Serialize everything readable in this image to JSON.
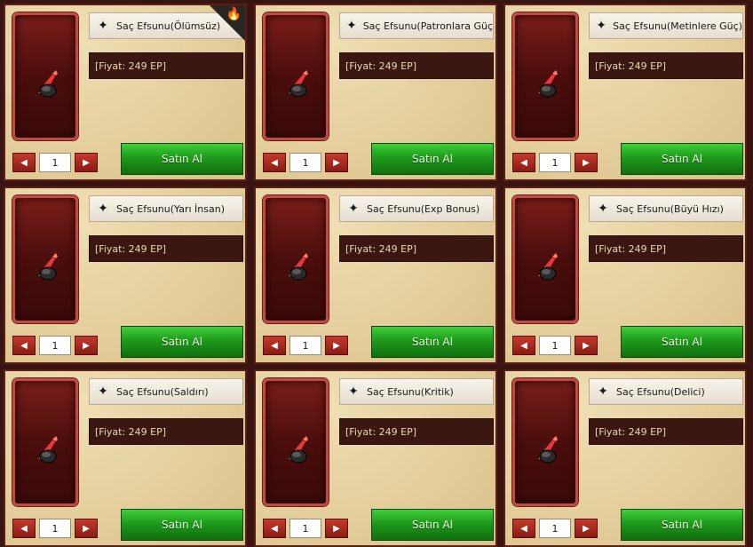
{
  "cards": [
    {
      "title": "Saç Efsunu(Ölümsüz)",
      "price": "[Fiyat: 249 EP]",
      "qty": "1",
      "buy": "Satın Al",
      "hot": true
    },
    {
      "title": "Saç Efsunu(Patronlara Güç",
      "price": "[Fiyat: 249 EP]",
      "qty": "1",
      "buy": "Satın Al",
      "hot": false
    },
    {
      "title": "Saç Efsunu(Metinlere Güç)",
      "price": "[Fiyat: 249 EP]",
      "qty": "1",
      "buy": "Satın Al",
      "hot": false
    },
    {
      "title": "Saç Efsunu(Yarı İnsan)",
      "price": "[Fiyat: 249 EP]",
      "qty": "1",
      "buy": "Satın Al",
      "hot": false
    },
    {
      "title": "Saç Efsunu(Exp Bonus)",
      "price": "[Fiyat: 249 EP]",
      "qty": "1",
      "buy": "Satın Al",
      "hot": false
    },
    {
      "title": "Saç Efsunu(Büyü Hızı)",
      "price": "[Fiyat: 249 EP]",
      "qty": "1",
      "buy": "Satın Al",
      "hot": false
    },
    {
      "title": "Saç Efsunu(Saldırı)",
      "price": "[Fiyat: 249 EP]",
      "qty": "1",
      "buy": "Satın Al",
      "hot": false
    },
    {
      "title": "Saç Efsunu(Kritik)",
      "price": "[Fiyat: 249 EP]",
      "qty": "1",
      "buy": "Satın Al",
      "hot": false
    },
    {
      "title": "Saç Efsunu(Delici)",
      "price": "[Fiyat: 249 EP]",
      "qty": "1",
      "buy": "Satın Al",
      "hot": false
    }
  ],
  "icons": {
    "title_icon": "sparkle-star-icon",
    "item_icon": "hair-item-icon",
    "hot_icon": "flame-icon",
    "prev": "arrow-left-icon",
    "next": "arrow-right-icon"
  },
  "colors": {
    "panel": "#e6d3a4",
    "slot": "#6b1a15",
    "price_bg": "#3b1712",
    "buy": "#1f9a1c",
    "arrow": "#c53a2c"
  }
}
